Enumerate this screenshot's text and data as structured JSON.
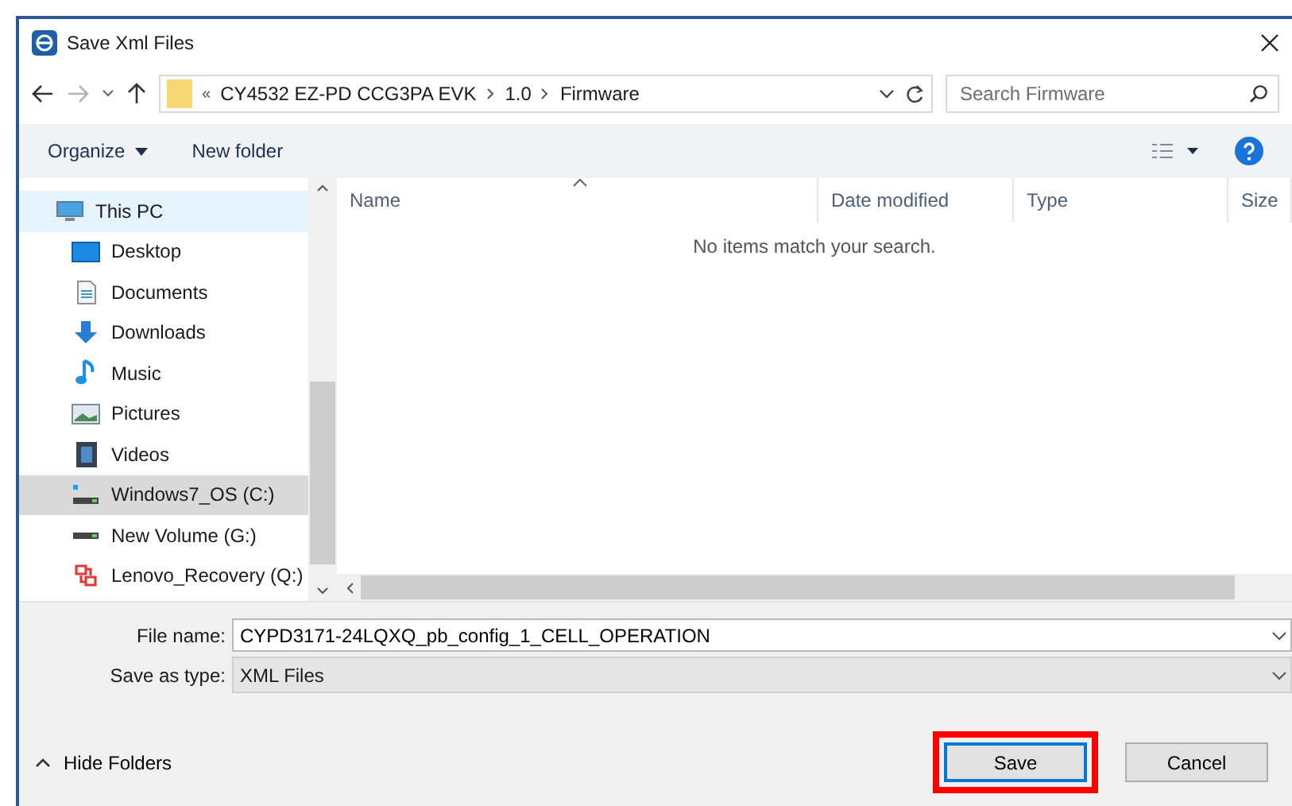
{
  "window": {
    "title": "Save Xml Files"
  },
  "nav": {
    "breadcrumb_prefix": "«",
    "path": [
      "CY4532 EZ-PD CCG3PA EVK",
      "1.0",
      "Firmware"
    ],
    "search": {
      "placeholder": "Search Firmware"
    }
  },
  "toolbar": {
    "organize": "Organize",
    "new_folder": "New folder"
  },
  "sidebar": {
    "items": [
      {
        "label": "This PC",
        "kind": "pc",
        "hovered": true,
        "selected": false,
        "child": false
      },
      {
        "label": "Desktop",
        "kind": "desktop",
        "hovered": false,
        "selected": false,
        "child": true
      },
      {
        "label": "Documents",
        "kind": "documents",
        "hovered": false,
        "selected": false,
        "child": true
      },
      {
        "label": "Downloads",
        "kind": "downloads",
        "hovered": false,
        "selected": false,
        "child": true
      },
      {
        "label": "Music",
        "kind": "music",
        "hovered": false,
        "selected": false,
        "child": true
      },
      {
        "label": "Pictures",
        "kind": "pictures",
        "hovered": false,
        "selected": false,
        "child": true
      },
      {
        "label": "Videos",
        "kind": "videos",
        "hovered": false,
        "selected": false,
        "child": true
      },
      {
        "label": "Windows7_OS (C:)",
        "kind": "osdrive",
        "hovered": false,
        "selected": true,
        "child": true
      },
      {
        "label": "New Volume (G:)",
        "kind": "drive",
        "hovered": false,
        "selected": false,
        "child": true
      },
      {
        "label": "Lenovo_Recovery (Q:)",
        "kind": "recovery",
        "hovered": false,
        "selected": false,
        "child": true
      }
    ]
  },
  "table": {
    "columns": [
      "Name",
      "Date modified",
      "Type",
      "Size"
    ],
    "empty_message": "No items match your search."
  },
  "form": {
    "file_name_label": "File name:",
    "file_name": "CYPD3171-24LQXQ_pb_config_1_CELL_OPERATION",
    "type_label": "Save as type:",
    "type": "XML Files"
  },
  "footer": {
    "hide_folders": "Hide Folders",
    "buttons": [
      {
        "label": "Save",
        "highlighted": true,
        "default": true
      },
      {
        "label": "Cancel",
        "highlighted": false,
        "default": false
      }
    ]
  }
}
